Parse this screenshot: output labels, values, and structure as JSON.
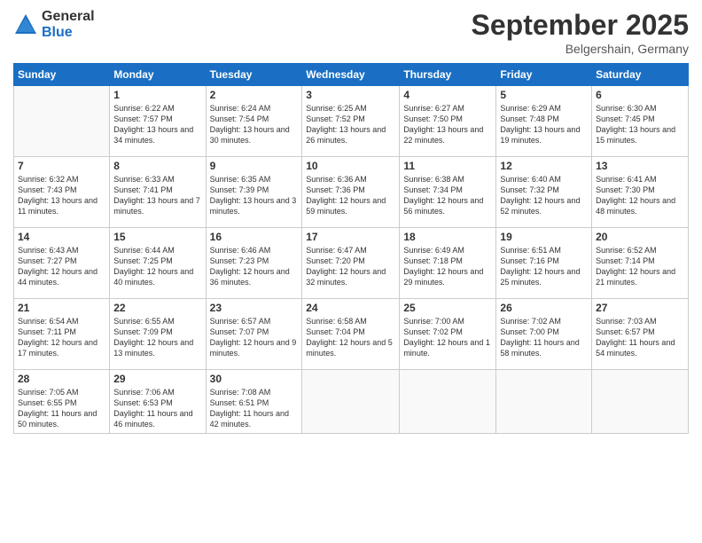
{
  "logo": {
    "general": "General",
    "blue": "Blue"
  },
  "title": "September 2025",
  "location": "Belgershain, Germany",
  "weekdays": [
    "Sunday",
    "Monday",
    "Tuesday",
    "Wednesday",
    "Thursday",
    "Friday",
    "Saturday"
  ],
  "weeks": [
    [
      {
        "day": "",
        "sunrise": "",
        "sunset": "",
        "daylight": ""
      },
      {
        "day": "1",
        "sunrise": "Sunrise: 6:22 AM",
        "sunset": "Sunset: 7:57 PM",
        "daylight": "Daylight: 13 hours and 34 minutes."
      },
      {
        "day": "2",
        "sunrise": "Sunrise: 6:24 AM",
        "sunset": "Sunset: 7:54 PM",
        "daylight": "Daylight: 13 hours and 30 minutes."
      },
      {
        "day": "3",
        "sunrise": "Sunrise: 6:25 AM",
        "sunset": "Sunset: 7:52 PM",
        "daylight": "Daylight: 13 hours and 26 minutes."
      },
      {
        "day": "4",
        "sunrise": "Sunrise: 6:27 AM",
        "sunset": "Sunset: 7:50 PM",
        "daylight": "Daylight: 13 hours and 22 minutes."
      },
      {
        "day": "5",
        "sunrise": "Sunrise: 6:29 AM",
        "sunset": "Sunset: 7:48 PM",
        "daylight": "Daylight: 13 hours and 19 minutes."
      },
      {
        "day": "6",
        "sunrise": "Sunrise: 6:30 AM",
        "sunset": "Sunset: 7:45 PM",
        "daylight": "Daylight: 13 hours and 15 minutes."
      }
    ],
    [
      {
        "day": "7",
        "sunrise": "Sunrise: 6:32 AM",
        "sunset": "Sunset: 7:43 PM",
        "daylight": "Daylight: 13 hours and 11 minutes."
      },
      {
        "day": "8",
        "sunrise": "Sunrise: 6:33 AM",
        "sunset": "Sunset: 7:41 PM",
        "daylight": "Daylight: 13 hours and 7 minutes."
      },
      {
        "day": "9",
        "sunrise": "Sunrise: 6:35 AM",
        "sunset": "Sunset: 7:39 PM",
        "daylight": "Daylight: 13 hours and 3 minutes."
      },
      {
        "day": "10",
        "sunrise": "Sunrise: 6:36 AM",
        "sunset": "Sunset: 7:36 PM",
        "daylight": "Daylight: 12 hours and 59 minutes."
      },
      {
        "day": "11",
        "sunrise": "Sunrise: 6:38 AM",
        "sunset": "Sunset: 7:34 PM",
        "daylight": "Daylight: 12 hours and 56 minutes."
      },
      {
        "day": "12",
        "sunrise": "Sunrise: 6:40 AM",
        "sunset": "Sunset: 7:32 PM",
        "daylight": "Daylight: 12 hours and 52 minutes."
      },
      {
        "day": "13",
        "sunrise": "Sunrise: 6:41 AM",
        "sunset": "Sunset: 7:30 PM",
        "daylight": "Daylight: 12 hours and 48 minutes."
      }
    ],
    [
      {
        "day": "14",
        "sunrise": "Sunrise: 6:43 AM",
        "sunset": "Sunset: 7:27 PM",
        "daylight": "Daylight: 12 hours and 44 minutes."
      },
      {
        "day": "15",
        "sunrise": "Sunrise: 6:44 AM",
        "sunset": "Sunset: 7:25 PM",
        "daylight": "Daylight: 12 hours and 40 minutes."
      },
      {
        "day": "16",
        "sunrise": "Sunrise: 6:46 AM",
        "sunset": "Sunset: 7:23 PM",
        "daylight": "Daylight: 12 hours and 36 minutes."
      },
      {
        "day": "17",
        "sunrise": "Sunrise: 6:47 AM",
        "sunset": "Sunset: 7:20 PM",
        "daylight": "Daylight: 12 hours and 32 minutes."
      },
      {
        "day": "18",
        "sunrise": "Sunrise: 6:49 AM",
        "sunset": "Sunset: 7:18 PM",
        "daylight": "Daylight: 12 hours and 29 minutes."
      },
      {
        "day": "19",
        "sunrise": "Sunrise: 6:51 AM",
        "sunset": "Sunset: 7:16 PM",
        "daylight": "Daylight: 12 hours and 25 minutes."
      },
      {
        "day": "20",
        "sunrise": "Sunrise: 6:52 AM",
        "sunset": "Sunset: 7:14 PM",
        "daylight": "Daylight: 12 hours and 21 minutes."
      }
    ],
    [
      {
        "day": "21",
        "sunrise": "Sunrise: 6:54 AM",
        "sunset": "Sunset: 7:11 PM",
        "daylight": "Daylight: 12 hours and 17 minutes."
      },
      {
        "day": "22",
        "sunrise": "Sunrise: 6:55 AM",
        "sunset": "Sunset: 7:09 PM",
        "daylight": "Daylight: 12 hours and 13 minutes."
      },
      {
        "day": "23",
        "sunrise": "Sunrise: 6:57 AM",
        "sunset": "Sunset: 7:07 PM",
        "daylight": "Daylight: 12 hours and 9 minutes."
      },
      {
        "day": "24",
        "sunrise": "Sunrise: 6:58 AM",
        "sunset": "Sunset: 7:04 PM",
        "daylight": "Daylight: 12 hours and 5 minutes."
      },
      {
        "day": "25",
        "sunrise": "Sunrise: 7:00 AM",
        "sunset": "Sunset: 7:02 PM",
        "daylight": "Daylight: 12 hours and 1 minute."
      },
      {
        "day": "26",
        "sunrise": "Sunrise: 7:02 AM",
        "sunset": "Sunset: 7:00 PM",
        "daylight": "Daylight: 11 hours and 58 minutes."
      },
      {
        "day": "27",
        "sunrise": "Sunrise: 7:03 AM",
        "sunset": "Sunset: 6:57 PM",
        "daylight": "Daylight: 11 hours and 54 minutes."
      }
    ],
    [
      {
        "day": "28",
        "sunrise": "Sunrise: 7:05 AM",
        "sunset": "Sunset: 6:55 PM",
        "daylight": "Daylight: 11 hours and 50 minutes."
      },
      {
        "day": "29",
        "sunrise": "Sunrise: 7:06 AM",
        "sunset": "Sunset: 6:53 PM",
        "daylight": "Daylight: 11 hours and 46 minutes."
      },
      {
        "day": "30",
        "sunrise": "Sunrise: 7:08 AM",
        "sunset": "Sunset: 6:51 PM",
        "daylight": "Daylight: 11 hours and 42 minutes."
      },
      {
        "day": "",
        "sunrise": "",
        "sunset": "",
        "daylight": ""
      },
      {
        "day": "",
        "sunrise": "",
        "sunset": "",
        "daylight": ""
      },
      {
        "day": "",
        "sunrise": "",
        "sunset": "",
        "daylight": ""
      },
      {
        "day": "",
        "sunrise": "",
        "sunset": "",
        "daylight": ""
      }
    ]
  ]
}
